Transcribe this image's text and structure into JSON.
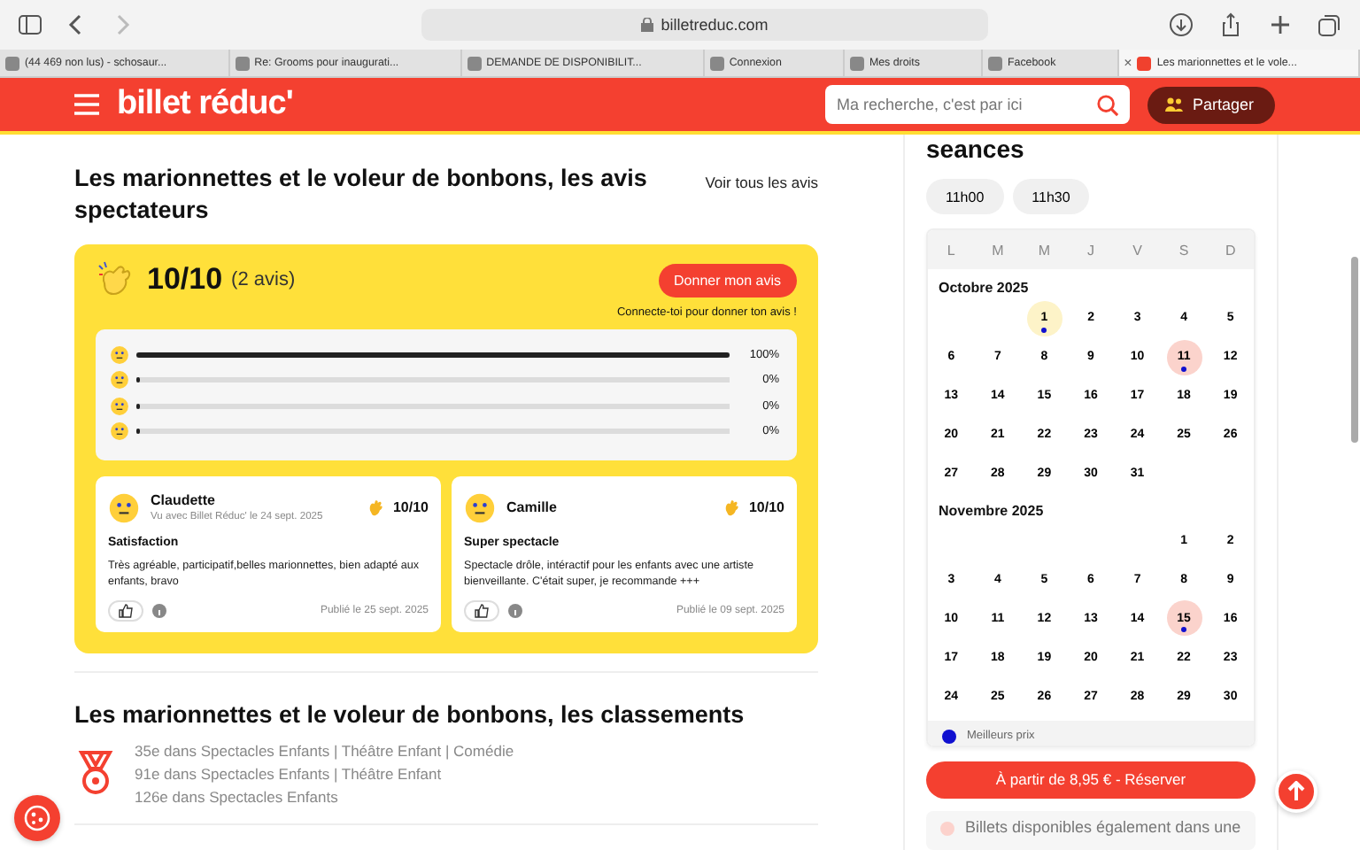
{
  "browser": {
    "url": "billetreduc.com",
    "tabs": [
      {
        "title": "(44 469 non lus) - schosaur...",
        "selected": false
      },
      {
        "title": "Re: Grooms pour inaugurati...",
        "selected": false
      },
      {
        "title": "DEMANDE DE DISPONIBILIT...",
        "selected": false
      },
      {
        "title": "Connexion",
        "selected": false
      },
      {
        "title": "Mes droits",
        "selected": false
      },
      {
        "title": "Facebook",
        "selected": false
      },
      {
        "title": "Les marionnettes et le vole...",
        "selected": true
      }
    ],
    "close": "×"
  },
  "header": {
    "logo": "billet réduc'",
    "search": {
      "placeholder": "Ma recherche, c'est par ici"
    },
    "share_button": "Partager"
  },
  "reviews": {
    "title": "Les marionnettes et le voleur de bonbons, les avis spectateurs",
    "see_all": "Voir tous les avis",
    "score": "10/10",
    "count": "(2 avis)",
    "give_button": "Donner mon avis",
    "login_hint": "Connecte-toi pour donner ton avis !",
    "distribution": [
      {
        "level": 1,
        "reading": "100%"
      },
      {
        "level": 0,
        "reading": "0%"
      },
      {
        "level": 0,
        "reading": "0%"
      },
      {
        "level": 0,
        "reading": "0%"
      }
    ],
    "items": [
      {
        "author": "Claudette",
        "meta": "Vu avec Billet Réduc' le 24 sept. 2025",
        "score": "10/10",
        "title": "Satisfaction",
        "text": "Très agréable, participatif,belles marionnettes, bien adapté aux enfants, bravo",
        "published": "Publié le 25 sept. 2025"
      },
      {
        "author": "Camille",
        "score": "10/10",
        "title": "Super spectacle",
        "text": "Spectacle drôle, intéractif pour les enfants avec une artiste bienveillante. C'était super, je recommande +++",
        "published": "Publié le 09 sept. 2025"
      }
    ]
  },
  "rankings": {
    "title": "Les marionnettes et le voleur de bonbons, les classements",
    "lines": [
      "35e dans Spectacles Enfants | Théâtre Enfant | Comédie",
      "91e dans Spectacles Enfants | Théâtre Enfant",
      "126e dans Spectacles Enfants"
    ]
  },
  "booking": {
    "title": "seances",
    "times": [
      {
        "label": "11h00",
        "selected": false
      },
      {
        "label": "11h30",
        "selected": false
      }
    ],
    "weekdays": [
      "L",
      "M",
      "M",
      "J",
      "V",
      "S",
      "D"
    ],
    "months": [
      {
        "name": "Octobre 2025",
        "weeks": [
          {
            "leading_gap": true,
            "days": [
              {
                "day": "1",
                "today": true,
                "selected": false,
                "best_price": true
              },
              {
                "day": "2",
                "today": false,
                "selected": false,
                "best_price": false
              },
              {
                "day": "3",
                "today": false,
                "selected": false,
                "best_price": false
              },
              {
                "day": "4",
                "today": false,
                "selected": false,
                "best_price": false
              },
              {
                "day": "5",
                "today": false,
                "selected": false,
                "best_price": false
              }
            ]
          },
          {
            "leading_gap": false,
            "days": [
              {
                "day": "6",
                "today": false,
                "selected": false,
                "best_price": false
              },
              {
                "day": "7",
                "today": false,
                "selected": false,
                "best_price": false
              },
              {
                "day": "8",
                "today": false,
                "selected": false,
                "best_price": false
              },
              {
                "day": "9",
                "today": false,
                "selected": false,
                "best_price": false
              },
              {
                "day": "10",
                "today": false,
                "selected": false,
                "best_price": false
              },
              {
                "day": "11",
                "today": false,
                "selected": true,
                "best_price": true
              },
              {
                "day": "12",
                "today": false,
                "selected": false,
                "best_price": false
              }
            ]
          },
          {
            "leading_gap": false,
            "days": [
              {
                "day": "13",
                "today": false,
                "selected": false,
                "best_price": false
              },
              {
                "day": "14",
                "today": false,
                "selected": false,
                "best_price": false
              },
              {
                "day": "15",
                "today": false,
                "selected": false,
                "best_price": false
              },
              {
                "day": "16",
                "today": false,
                "selected": false,
                "best_price": false
              },
              {
                "day": "17",
                "today": false,
                "selected": false,
                "best_price": false
              },
              {
                "day": "18",
                "today": false,
                "selected": false,
                "best_price": false
              },
              {
                "day": "19",
                "today": false,
                "selected": false,
                "best_price": false
              }
            ]
          },
          {
            "leading_gap": false,
            "days": [
              {
                "day": "20",
                "today": false,
                "selected": false,
                "best_price": false
              },
              {
                "day": "21",
                "today": false,
                "selected": false,
                "best_price": false
              },
              {
                "day": "22",
                "today": false,
                "selected": false,
                "best_price": false
              },
              {
                "day": "23",
                "today": false,
                "selected": false,
                "best_price": false
              },
              {
                "day": "24",
                "today": false,
                "selected": false,
                "best_price": false
              },
              {
                "day": "25",
                "today": false,
                "selected": false,
                "best_price": false
              },
              {
                "day": "26",
                "today": false,
                "selected": false,
                "best_price": false
              }
            ]
          },
          {
            "leading_gap": false,
            "days": [
              {
                "day": "27",
                "today": false,
                "selected": false,
                "best_price": false
              },
              {
                "day": "28",
                "today": false,
                "selected": false,
                "best_price": false
              },
              {
                "day": "29",
                "today": false,
                "selected": false,
                "best_price": false
              },
              {
                "day": "30",
                "today": false,
                "selected": false,
                "best_price": false
              },
              {
                "day": "31",
                "today": false,
                "selected": false,
                "best_price": false
              }
            ]
          }
        ]
      },
      {
        "name": "Novembre 2025",
        "weeks": [
          {
            "leading_gap": true,
            "days": [
              {
                "day": "1",
                "today": false,
                "selected": false,
                "best_price": false
              },
              {
                "day": "2",
                "today": false,
                "selected": false,
                "best_price": false
              }
            ]
          },
          {
            "leading_gap": false,
            "days": [
              {
                "day": "3",
                "today": false,
                "selected": false,
                "best_price": false
              },
              {
                "day": "4",
                "today": false,
                "selected": false,
                "best_price": false
              },
              {
                "day": "5",
                "today": false,
                "selected": false,
                "best_price": false
              },
              {
                "day": "6",
                "today": false,
                "selected": false,
                "best_price": false
              },
              {
                "day": "7",
                "today": false,
                "selected": false,
                "best_price": false
              },
              {
                "day": "8",
                "today": false,
                "selected": false,
                "best_price": false
              },
              {
                "day": "9",
                "today": false,
                "selected": false,
                "best_price": false
              }
            ]
          },
          {
            "leading_gap": false,
            "days": [
              {
                "day": "10",
                "today": false,
                "selected": false,
                "best_price": false
              },
              {
                "day": "11",
                "today": false,
                "selected": false,
                "best_price": false
              },
              {
                "day": "12",
                "today": false,
                "selected": false,
                "best_price": false
              },
              {
                "day": "13",
                "today": false,
                "selected": false,
                "best_price": false
              },
              {
                "day": "14",
                "today": false,
                "selected": false,
                "best_price": false
              },
              {
                "day": "15",
                "today": false,
                "selected": true,
                "best_price": true
              },
              {
                "day": "16",
                "today": false,
                "selected": false,
                "best_price": false
              }
            ]
          },
          {
            "leading_gap": false,
            "days": [
              {
                "day": "17",
                "today": false,
                "selected": false,
                "best_price": false
              },
              {
                "day": "18",
                "today": false,
                "selected": false,
                "best_price": false
              },
              {
                "day": "19",
                "today": false,
                "selected": false,
                "best_price": false
              },
              {
                "day": "20",
                "today": false,
                "selected": false,
                "best_price": false
              },
              {
                "day": "21",
                "today": false,
                "selected": false,
                "best_price": false
              },
              {
                "day": "22",
                "today": false,
                "selected": false,
                "best_price": false
              },
              {
                "day": "23",
                "today": false,
                "selected": false,
                "best_price": false
              }
            ]
          },
          {
            "leading_gap": false,
            "days": [
              {
                "day": "24",
                "today": false,
                "selected": false,
                "best_price": false
              },
              {
                "day": "25",
                "today": false,
                "selected": false,
                "best_price": false
              },
              {
                "day": "26",
                "today": false,
                "selected": false,
                "best_price": false
              },
              {
                "day": "27",
                "today": false,
                "selected": false,
                "best_price": false
              },
              {
                "day": "28",
                "today": false,
                "selected": false,
                "best_price": false
              },
              {
                "day": "29",
                "today": false,
                "selected": false,
                "best_price": false
              },
              {
                "day": "30",
                "today": false,
                "selected": false,
                "best_price": false
              }
            ]
          }
        ]
      }
    ],
    "legend": "Meilleurs prix",
    "book_button": "À partir de 8,95 € - Réserver",
    "notice": "Billets disponibles également dans une"
  }
}
